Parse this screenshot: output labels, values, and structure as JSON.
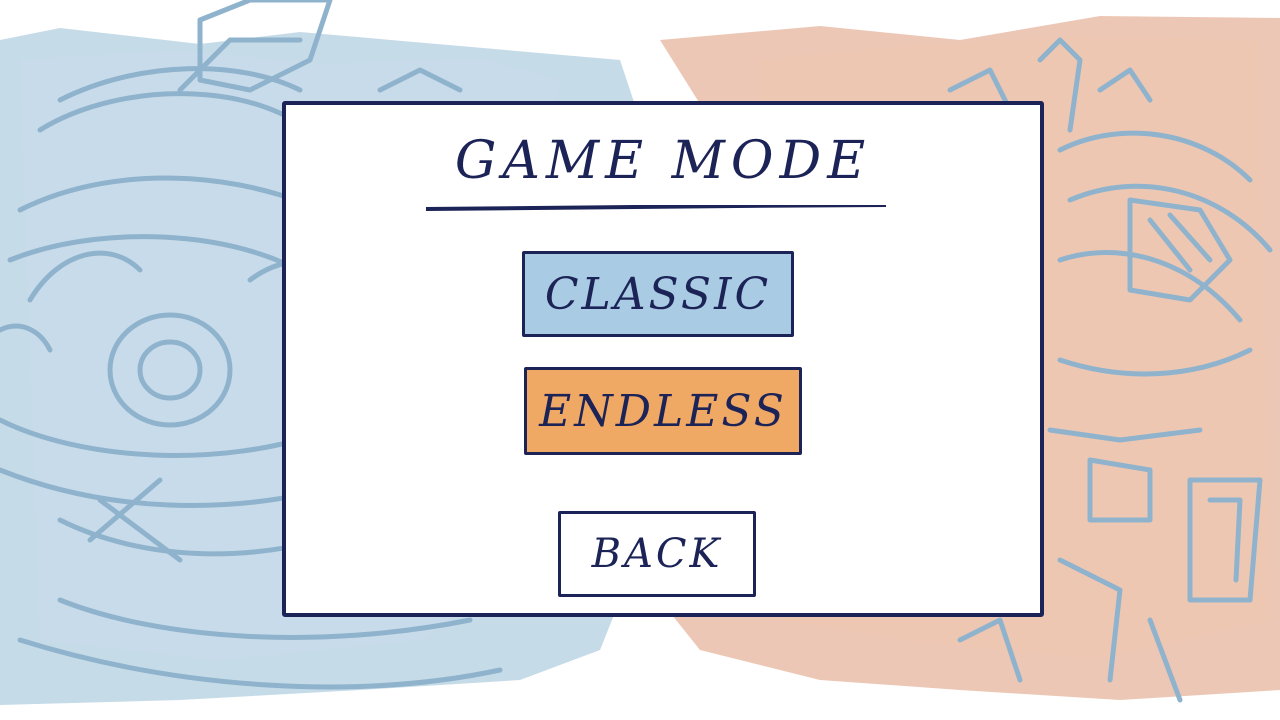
{
  "screen": {
    "title": "GAME MODE"
  },
  "buttons": {
    "classic_label": "CLASSIC",
    "endless_label": "ENDLESS",
    "back_label": "BACK"
  },
  "colors": {
    "ink": "#1c2357",
    "classic_fill": "#a9cbe3",
    "endless_fill": "#f0a865",
    "left_wash": "#bcd5e4",
    "right_wash": "#e9b9a2",
    "sketch_line": "#8fb3cc"
  },
  "background": {
    "left_art": "robot-sketch",
    "right_art": "mech-sketch"
  }
}
